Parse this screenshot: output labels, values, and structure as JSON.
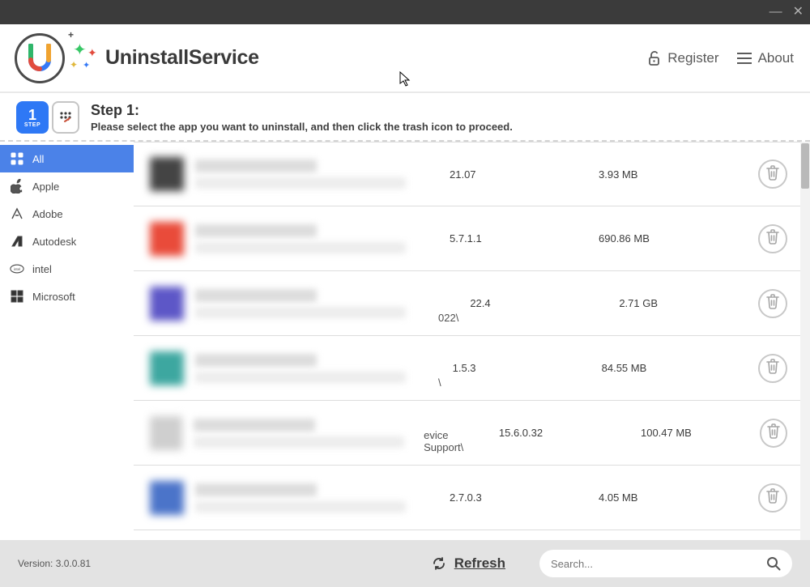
{
  "window": {
    "minimize_label": "—",
    "close_label": "✕"
  },
  "app": {
    "name": "UninstallService"
  },
  "header": {
    "register_label": "Register",
    "about_label": "About"
  },
  "step": {
    "badge_number": "1",
    "badge_text": "STEP",
    "title": "Step 1:",
    "description": "Please select the app you want to uninstall, and then click the trash icon to proceed."
  },
  "sidebar": {
    "items": [
      {
        "label": "All",
        "icon": "grid-icon",
        "active": true
      },
      {
        "label": "Apple",
        "icon": "apple-icon",
        "active": false
      },
      {
        "label": "Adobe",
        "icon": "adobe-icon",
        "active": false
      },
      {
        "label": "Autodesk",
        "icon": "autodesk-icon",
        "active": false
      },
      {
        "label": "intel",
        "icon": "intel-icon",
        "active": false
      },
      {
        "label": "Microsoft",
        "icon": "microsoft-icon",
        "active": false
      }
    ]
  },
  "apps": [
    {
      "thumb_color": "#444",
      "path_tail": "",
      "version": "21.07",
      "size": "3.93 MB"
    },
    {
      "thumb_color": "#e94b3a",
      "path_tail": "",
      "version": "5.7.1.1",
      "size": "690.86 MB"
    },
    {
      "thumb_color": "#5d57c7",
      "path_tail": "022\\",
      "version": "22.4",
      "size": "2.71 GB"
    },
    {
      "thumb_color": "#3da7a0",
      "path_tail": "\\",
      "version": "1.5.3",
      "size": "84.55 MB"
    },
    {
      "thumb_color": "#cfcfcf",
      "path_tail": "evice Support\\",
      "version": "15.6.0.32",
      "size": "100.47 MB"
    },
    {
      "thumb_color": "#4b74c9",
      "path_tail": "",
      "version": "2.7.0.3",
      "size": "4.05 MB"
    }
  ],
  "footer": {
    "version_text": "Version: 3.0.0.81",
    "refresh_label": "Refresh",
    "search_placeholder": "Search..."
  }
}
